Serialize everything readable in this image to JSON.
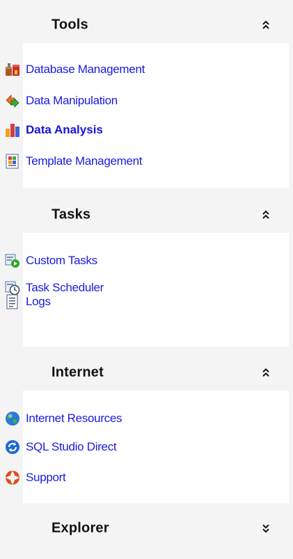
{
  "groups": {
    "tools": {
      "title": "Tools",
      "state": "expanded",
      "chevron_icon": "collapse-chevron-up-icon",
      "items": [
        {
          "label": "Database Management",
          "icon": "database-management-icon",
          "active": false
        },
        {
          "label": "Data Manipulation",
          "icon": "data-manipulation-icon",
          "active": false
        },
        {
          "label": "Data Analysis",
          "icon": "bar-chart-icon",
          "active": true
        },
        {
          "label": "Template Management",
          "icon": "template-icon",
          "active": false
        }
      ]
    },
    "tasks": {
      "title": "Tasks",
      "state": "expanded",
      "chevron_icon": "collapse-chevron-up-icon",
      "items": [
        {
          "label": "Custom Tasks",
          "icon": "custom-tasks-icon"
        },
        {
          "label": "Task Scheduler",
          "icon": "task-scheduler-icon"
        },
        {
          "label": "Logs",
          "icon": "logs-icon"
        }
      ]
    },
    "internet": {
      "title": "Internet",
      "state": "expanded",
      "chevron_icon": "collapse-chevron-up-icon",
      "items": [
        {
          "label": "Internet Resources",
          "icon": "globe-icon"
        },
        {
          "label": "SQL Studio Direct",
          "icon": "refresh-globe-icon"
        },
        {
          "label": "Support",
          "icon": "lifebuoy-icon"
        }
      ]
    },
    "explorer": {
      "title": "Explorer",
      "state": "collapsed",
      "chevron_icon": "expand-chevron-down-icon"
    }
  },
  "colors": {
    "pane_background": "#f4f4f4",
    "group_body": "#ffffff",
    "link": "#1a1adf",
    "header_text": "#111111"
  }
}
